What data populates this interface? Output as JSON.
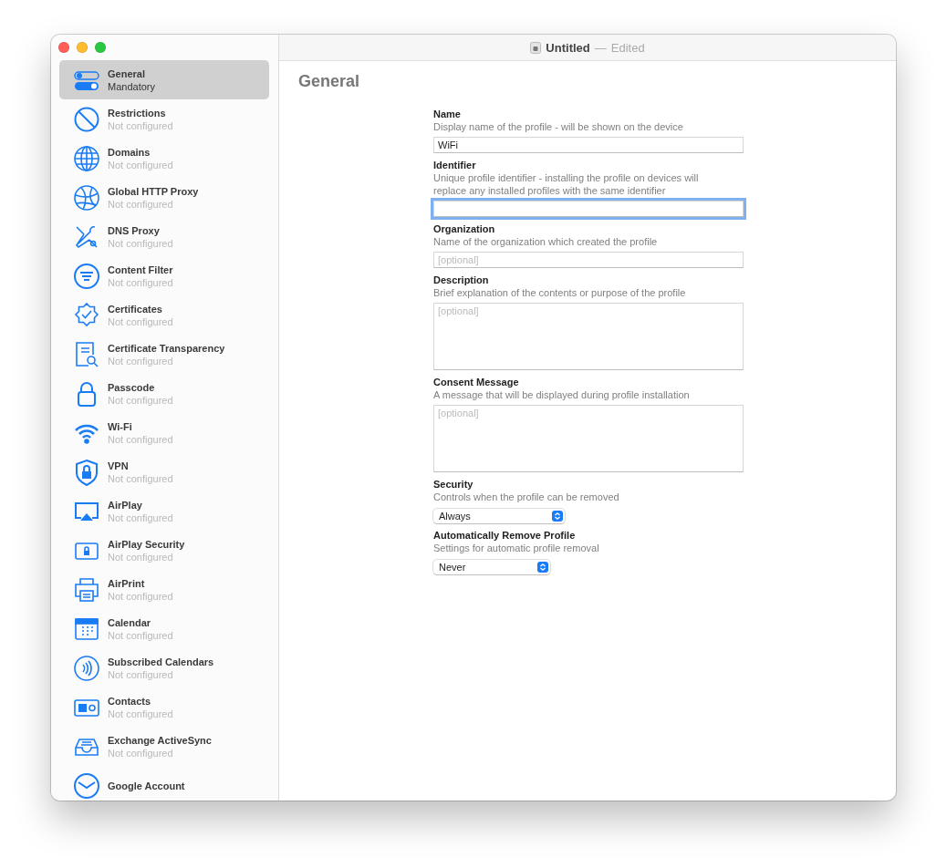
{
  "window": {
    "title": "Untitled",
    "separator": "—",
    "status": "Edited"
  },
  "sidebar": {
    "items": [
      {
        "title": "General",
        "status": "Mandatory",
        "selected": true
      },
      {
        "title": "Restrictions",
        "status": "Not configured",
        "selected": false
      },
      {
        "title": "Domains",
        "status": "Not configured",
        "selected": false
      },
      {
        "title": "Global HTTP Proxy",
        "status": "Not configured",
        "selected": false
      },
      {
        "title": "DNS Proxy",
        "status": "Not configured",
        "selected": false
      },
      {
        "title": "Content Filter",
        "status": "Not configured",
        "selected": false
      },
      {
        "title": "Certificates",
        "status": "Not configured",
        "selected": false
      },
      {
        "title": "Certificate Transparency",
        "status": "Not configured",
        "selected": false
      },
      {
        "title": "Passcode",
        "status": "Not configured",
        "selected": false
      },
      {
        "title": "Wi-Fi",
        "status": "Not configured",
        "selected": false
      },
      {
        "title": "VPN",
        "status": "Not configured",
        "selected": false
      },
      {
        "title": "AirPlay",
        "status": "Not configured",
        "selected": false
      },
      {
        "title": "AirPlay Security",
        "status": "Not configured",
        "selected": false
      },
      {
        "title": "AirPrint",
        "status": "Not configured",
        "selected": false
      },
      {
        "title": "Calendar",
        "status": "Not configured",
        "selected": false
      },
      {
        "title": "Subscribed Calendars",
        "status": "Not configured",
        "selected": false
      },
      {
        "title": "Contacts",
        "status": "Not configured",
        "selected": false
      },
      {
        "title": "Exchange ActiveSync",
        "status": "Not configured",
        "selected": false
      },
      {
        "title": "Google Account",
        "selected": false
      }
    ]
  },
  "content": {
    "heading": "General",
    "fields": [
      {
        "kind": "text",
        "label": "Name",
        "help": "Display name of the profile - will be shown on the device",
        "value": "WiFi",
        "focused": false
      },
      {
        "kind": "text",
        "label": "Identifier",
        "help": "Unique profile identifier - installing the profile on devices will replace any installed profiles with the same identifier",
        "focused": true
      },
      {
        "kind": "text",
        "label": "Organization",
        "help": "Name of the organization which created the profile",
        "placeholder": "[optional]",
        "focused": false
      },
      {
        "kind": "textarea",
        "label": "Description",
        "help": "Brief explanation of the contents or purpose of the profile",
        "placeholder": "[optional]",
        "focused": false
      },
      {
        "kind": "textarea",
        "label": "Consent Message",
        "help": "A message that will be displayed during profile installation",
        "placeholder": "[optional]",
        "focused": false
      },
      {
        "kind": "select",
        "label": "Security",
        "help": "Controls when the profile can be removed",
        "value": "Always",
        "focused": false
      },
      {
        "kind": "select",
        "label": "Automatically Remove Profile",
        "help": "Settings for automatic profile removal",
        "value": "Never",
        "focused": false
      }
    ]
  }
}
